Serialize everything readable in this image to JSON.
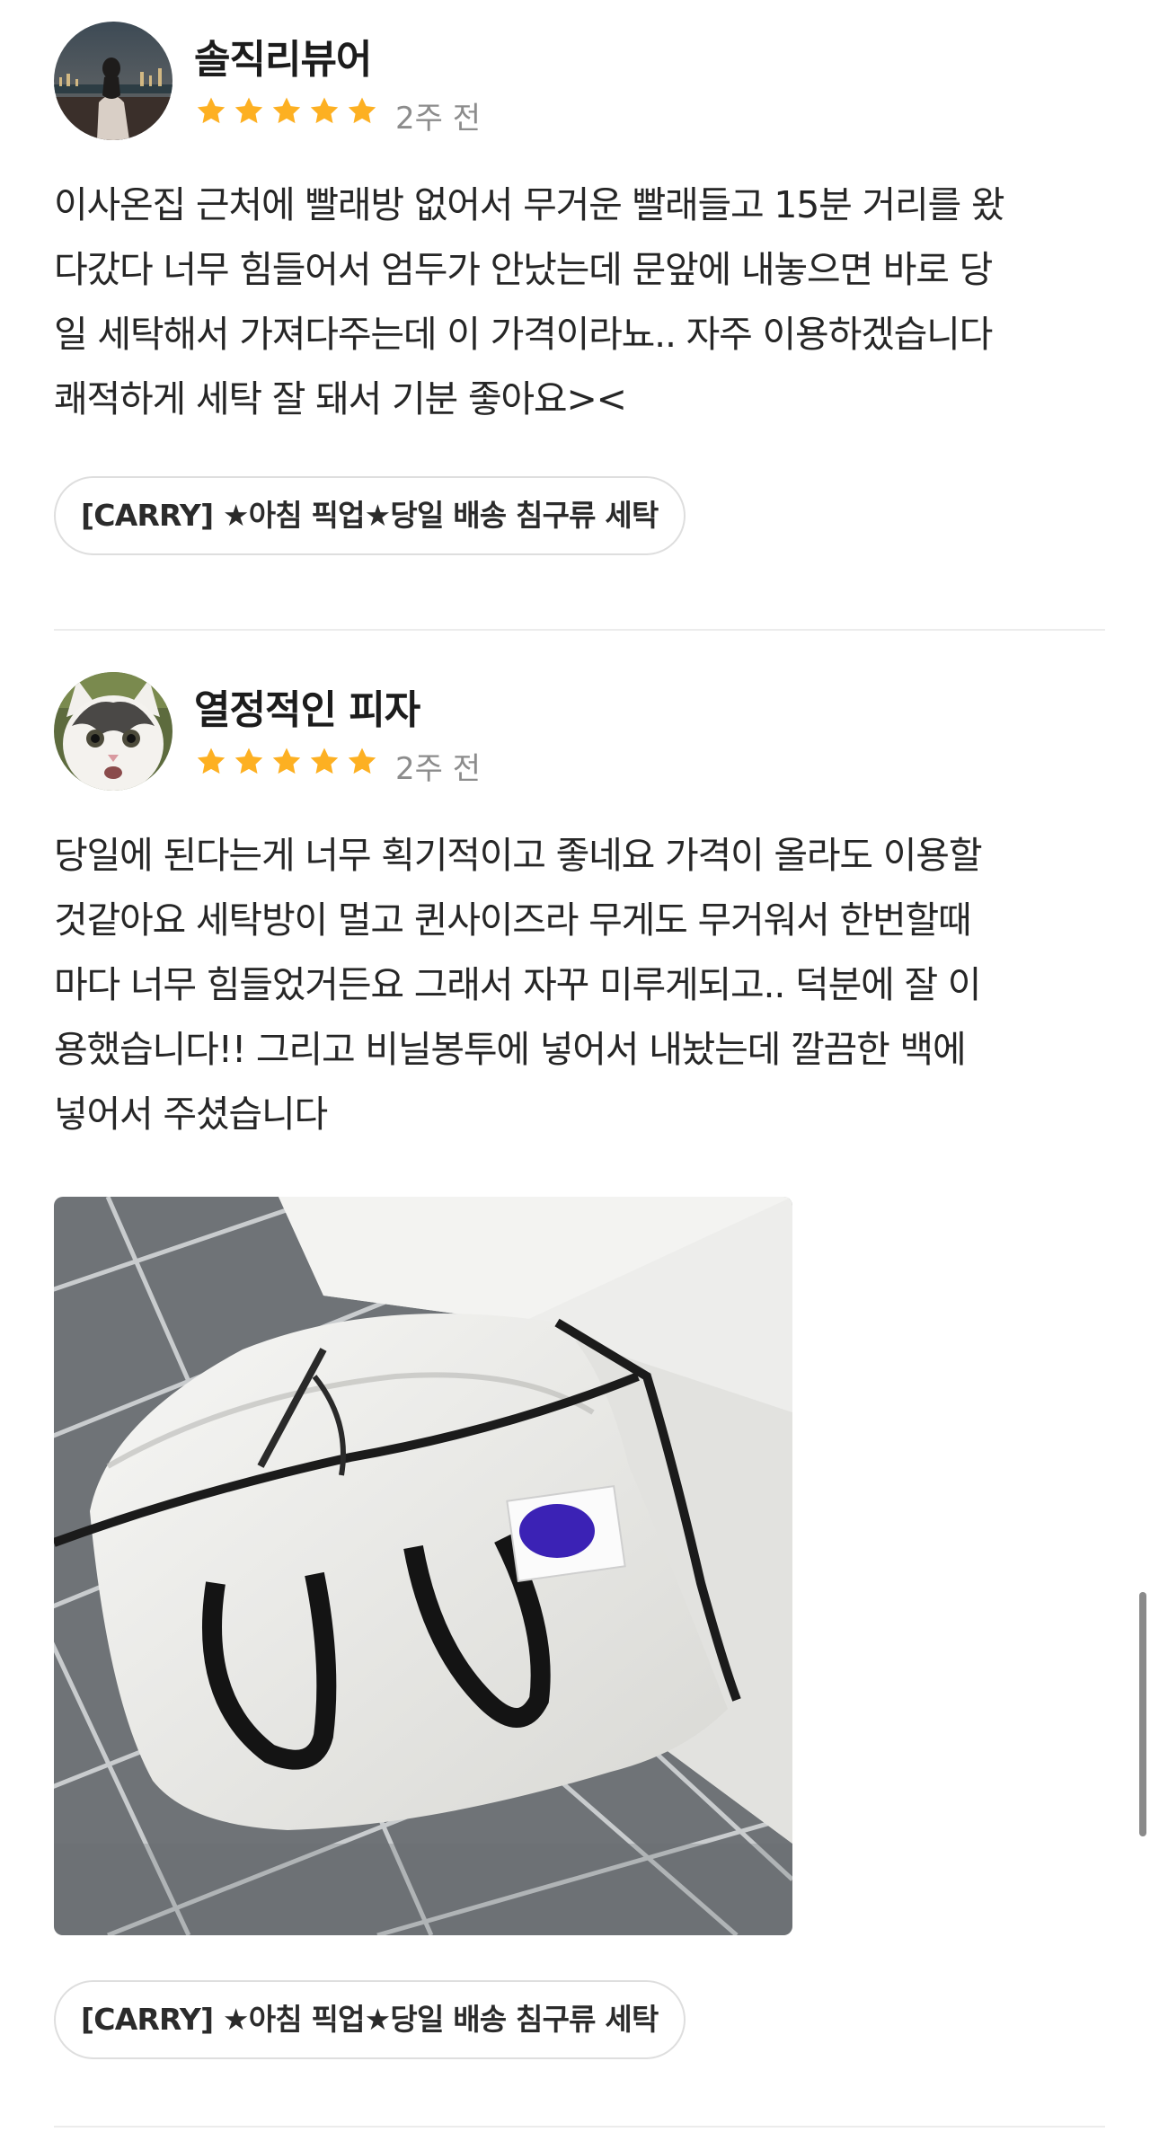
{
  "reviews": [
    {
      "reviewer": "솔직리뷰어",
      "rating": 5,
      "time_ago": "2주 전",
      "avatar": "night-cityscape-photo-avatar",
      "text_lines": [
        "이사온집 근처에 빨래방 없어서 무거운 빨래들고 15분 거리를 왔",
        "다갔다 너무 힘들어서 엄두가 안났는데 문앞에 내놓으면 바로 당",
        "일 세탁해서 가져다주는데 이 가격이라뇨.. 자주 이용하겠습니다",
        "쾌적하게 세탁 잘 돼서 기분 좋아요><"
      ],
      "product_tag": "[CARRY] ★아침 픽업★당일 배송 침구류 세탁"
    },
    {
      "reviewer": "열정적인 피자",
      "rating": 5,
      "time_ago": "2주 전",
      "avatar": "cat-photo-avatar",
      "text_lines": [
        "당일에 된다는게 너무 획기적이고 좋네요 가격이 올라도 이용할",
        "것같아요 세탁방이 멀고 퀸사이즈라 무게도 무거워서 한번할때",
        "마다 너무 힘들었거든요 그래서 자꾸 미루게되고.. 덕분에 잘 이",
        "용했습니다!! 그리고 비닐봉투에 넣어서 내놨는데 깔끔한 백에",
        "넣어서 주셨습니다"
      ],
      "photo": "laundry-bag-on-tile-floor-photo",
      "product_tag": "[CARRY] ★아침 픽업★당일 배송 침구류 세탁"
    }
  ],
  "colors": {
    "star": "#FDB022",
    "text": "#262626",
    "muted": "#8C8C8C",
    "divider": "#ECECEC",
    "chip_border": "#DEDEDE"
  }
}
